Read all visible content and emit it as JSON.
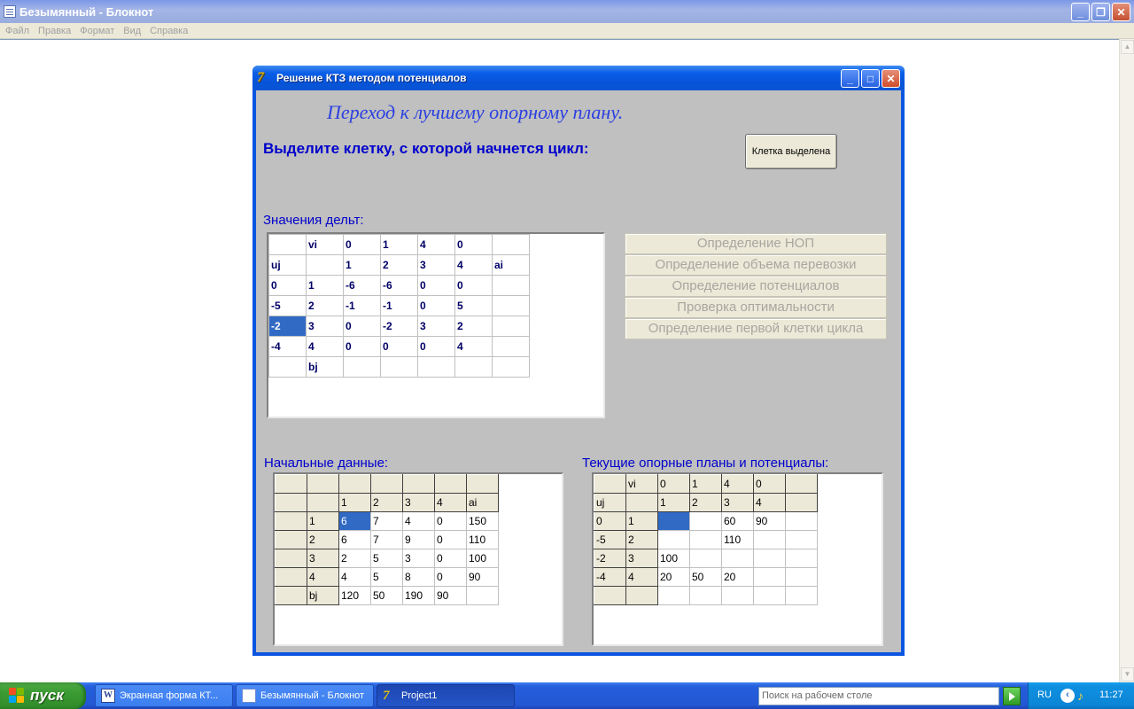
{
  "notepad": {
    "title": "Безымянный - Блокнот",
    "menu": [
      "Файл",
      "Правка",
      "Формат",
      "Вид",
      "Справка"
    ]
  },
  "dialog": {
    "title": "Решение КТЗ методом потенциалов",
    "subtitle": "Переход к лучшему опорному плану.",
    "prompt": "Выделите клетку, с которой начнется цикл:",
    "cell_selected_button": "Клетка выделена",
    "delta_label": "Значения дельт:",
    "initial_label": "Начальные данные:",
    "current_label": "Текущие опорные планы и потенциалы:",
    "step_buttons": [
      "Определение НОП",
      "Определение объема перевозки",
      "Определение потенциалов",
      "Проверка оптимальности",
      "Определение первой клетки цикла"
    ],
    "delta_grid": [
      [
        "",
        "vi",
        "0",
        "1",
        "4",
        "0",
        ""
      ],
      [
        "uj",
        "",
        "1",
        "2",
        "3",
        "4",
        "ai"
      ],
      [
        "0",
        "1",
        "-6",
        "-6",
        "0",
        "0",
        ""
      ],
      [
        "-5",
        "2",
        "-1",
        "-1",
        "0",
        "5",
        ""
      ],
      [
        "-2",
        "3",
        "0",
        "-2",
        "3",
        "2",
        ""
      ],
      [
        "-4",
        "4",
        "0",
        "0",
        "0",
        "4",
        ""
      ],
      [
        "",
        "bj",
        "",
        "",
        "",
        "",
        ""
      ]
    ],
    "initial_grid": [
      [
        "",
        "",
        "",
        "",
        "",
        "",
        ""
      ],
      [
        "",
        "",
        "1",
        "2",
        "3",
        "4",
        "ai"
      ],
      [
        "",
        "1",
        "6",
        "7",
        "4",
        "0",
        "150"
      ],
      [
        "",
        "2",
        "6",
        "7",
        "9",
        "0",
        "110"
      ],
      [
        "",
        "3",
        "2",
        "5",
        "3",
        "0",
        "100"
      ],
      [
        "",
        "4",
        "4",
        "5",
        "8",
        "0",
        "90"
      ],
      [
        "",
        "bj",
        "120",
        "50",
        "190",
        "90",
        ""
      ]
    ],
    "current_grid": [
      [
        "",
        "vi",
        "0",
        "1",
        "4",
        "0",
        ""
      ],
      [
        "uj",
        "",
        "1",
        "2",
        "3",
        "4",
        ""
      ],
      [
        "0",
        "1",
        "",
        "",
        "60",
        "90",
        ""
      ],
      [
        "-5",
        "2",
        "",
        "",
        "110",
        "",
        ""
      ],
      [
        "-2",
        "3",
        "100",
        "",
        "",
        "",
        ""
      ],
      [
        "-4",
        "4",
        "20",
        "50",
        "20",
        "",
        ""
      ],
      [
        "",
        "",
        "",
        "",
        "",
        "",
        ""
      ]
    ]
  },
  "taskbar": {
    "start_label": "пуск",
    "tasks": [
      "Экранная форма КТ...",
      "Безымянный - Блокнот",
      "Project1"
    ],
    "search_placeholder": "Поиск на рабочем столе",
    "language": "RU",
    "clock": "11:27"
  },
  "colors": {
    "selection": "#316ac5",
    "label_blue": "#0000cc",
    "dialog_face": "#c0c0c0",
    "xp_blue": "#0b55e0"
  }
}
